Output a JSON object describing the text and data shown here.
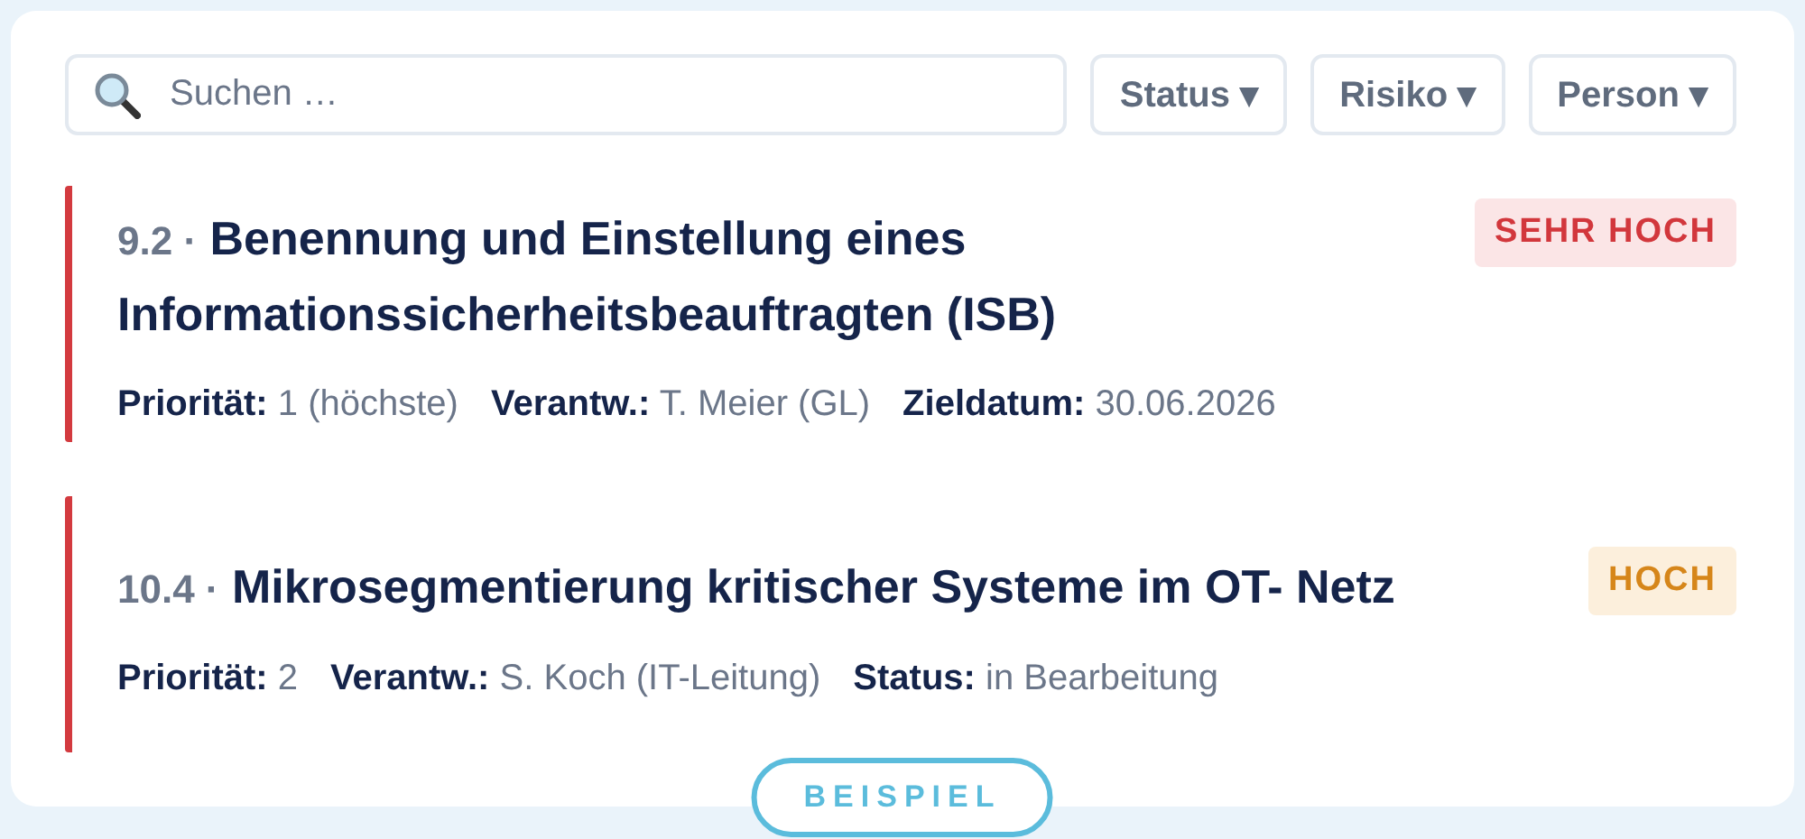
{
  "search": {
    "placeholder": "Suchen …"
  },
  "filters": [
    {
      "label": "Status ▾"
    },
    {
      "label": "Risiko ▾"
    },
    {
      "label": "Person ▾"
    }
  ],
  "measures": [
    {
      "number": "9.2 ·",
      "title": "Benennung und Einstellung eines Informationssicherheitsbeauftragten (ISB)",
      "risk": {
        "label": "SEHR HOCH",
        "kind": "very_high"
      },
      "meta": [
        {
          "label": "Priorität:",
          "value": "1 (höchste)"
        },
        {
          "label": "Verantw.:",
          "value": "T. Meier (GL)"
        },
        {
          "label": "Zieldatum:",
          "value": "30.06.2026"
        }
      ]
    },
    {
      "number": "10.4 ·",
      "title": "Mikrosegmentierung kritischer Systeme im OT- Netz",
      "risk": {
        "label": "HOCH",
        "kind": "high"
      },
      "meta": [
        {
          "label": "Priorität:",
          "value": "2"
        },
        {
          "label": "Verantw.:",
          "value": "S. Koch (IT-Leitung)"
        },
        {
          "label": "Status:",
          "value": "in Bearbeitung"
        }
      ]
    }
  ],
  "stamp": "BEISPIEL"
}
